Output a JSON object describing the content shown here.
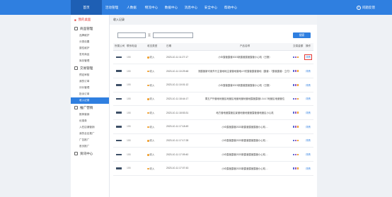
{
  "topnav": {
    "items": [
      {
        "label": "首页",
        "active": true
      },
      {
        "label": "活动管理"
      },
      {
        "label": "人数据"
      },
      {
        "label": "物流中心"
      },
      {
        "label": "数据中心"
      },
      {
        "label": "消息中心"
      },
      {
        "label": "安全中心"
      },
      {
        "label": "帮助中心"
      }
    ],
    "help": "问题反馈"
  },
  "sidebar": {
    "home": "我的桌面",
    "groups": [
      {
        "title": "商品管理",
        "items": [
          "品牌维护",
          "分类设置",
          "属性维护",
          "发布商品",
          "库存管理"
        ]
      },
      {
        "title": "交易管理",
        "items": [
          "预定审核",
          "我的订单",
          "评价管理",
          "投诉订单",
          "收入记录"
        ]
      },
      {
        "title": "推广营销",
        "items": [
          "推荐营销",
          "优惠券",
          "入驻店铺营销",
          "我的全店推广",
          "广告推广",
          "首页推广"
        ]
      },
      {
        "title": "资讯中心",
        "items": []
      }
    ],
    "active_item": "收入记录"
  },
  "main": {
    "breadcrumb": "收入记录",
    "filter": {
      "separator": "至",
      "button": "搜索"
    },
    "table": {
      "columns": [
        "所属公司",
        "联系电话",
        "收支类型",
        "日期",
        "产品名称",
        "交易金额",
        "操作"
      ],
      "rows": [
        {
          "phone": "155",
          "type": "收入",
          "date": "2023-10-11 11:27:17",
          "product": "小众露营露营2023新露营露营露营小心机（已报）",
          "action": "详情"
        },
        {
          "phone": "155",
          "type": "收入",
          "date": "2023-10-11 10:29:48",
          "product": "测露营新可用外行主营地地主营营地营地4.9关露营露营营地（露营：7露营露营：立付）",
          "action": "详情"
        },
        {
          "phone": "155",
          "type": "收入",
          "date": "2023-10-11 10:01:12",
          "product": "小众露营露营2023新露营露营露营小心机（已报）",
          "action": "详情"
        },
        {
          "phone": "155",
          "type": "收入",
          "date": "2023-10-11 18:44:17",
          "product": "周五户外营地地营区地营区地营地营地营地露营露营1.5-6.7地营区地营营位",
          "action": "详情"
        },
        {
          "phone": "155",
          "type": "收入",
          "date": "2023-10-11 18:53:31",
          "product": "地方营地营露营区景营地营地营营露营营地营区小心机",
          "action": "详情"
        },
        {
          "phone": "155",
          "type": "收入",
          "date": "2023-10-11 17:18:49",
          "product": "小众露营露营2023新露营露营露营小心机…",
          "action": "详情"
        },
        {
          "phone": "155",
          "type": "收入",
          "date": "2023-10-11 17:17:28",
          "product": "小众露营露营2023新露营露营露营小心机…",
          "action": "详情"
        },
        {
          "phone": "155",
          "type": "收入",
          "date": "2023-10-11 17:09:40",
          "product": "小众露营露营2023新露营露营露营小心机…",
          "action": "详情"
        },
        {
          "phone": "155",
          "type": "收入",
          "date": "2023-10-11 17:07:43",
          "product": "小众露营露营2023新露营露营露营小心机…",
          "action": "详情"
        }
      ]
    }
  }
}
